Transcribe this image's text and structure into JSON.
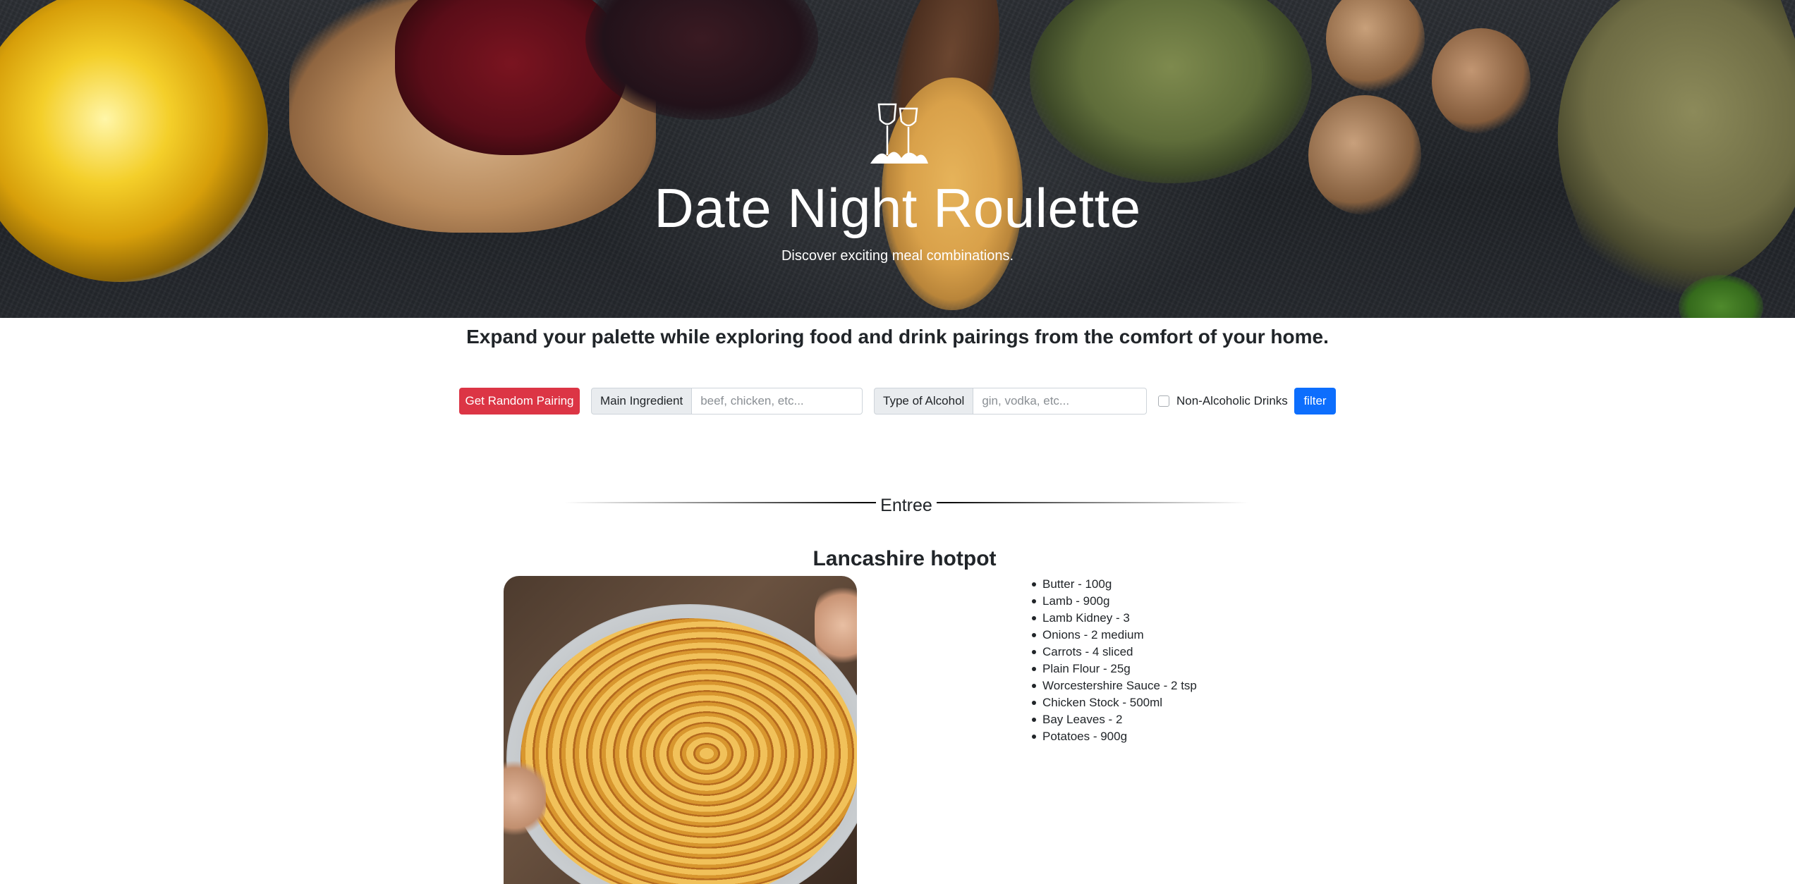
{
  "hero": {
    "logo_icon": "wine-glasses-icon",
    "title": "Date Night Roulette",
    "subtitle": "Discover exciting meal combinations."
  },
  "tagline": "Expand your palette while exploring food and drink pairings from the comfort of your home.",
  "controls": {
    "random_button": "Get Random Pairing",
    "main_ingredient": {
      "label": "Main Ingredient",
      "value": "",
      "placeholder": "beef, chicken, etc..."
    },
    "alcohol": {
      "label": "Type of Alcohol",
      "value": "",
      "placeholder": "gin, vodka, etc..."
    },
    "non_alcoholic": {
      "label": "Non-Alcoholic Drinks",
      "checked": false
    },
    "filter_button": "filter"
  },
  "section": {
    "heading": "Entree"
  },
  "recipe": {
    "title": "Lancashire hotpot",
    "image_alt": "Lancashire hotpot",
    "ingredients": [
      "Butter - 100g",
      "Lamb - 900g",
      "Lamb Kidney - 3",
      "Onions - 2 medium",
      "Carrots - 4 sliced",
      "Plain Flour - 25g",
      "Worcestershire Sauce - 2 tsp",
      "Chicken Stock - 500ml",
      "Bay Leaves - 2",
      "Potatoes - 900g"
    ]
  },
  "colors": {
    "random_button": "#dc3545",
    "filter_button": "#0d6efd",
    "input_label_bg": "#e9ecef"
  }
}
